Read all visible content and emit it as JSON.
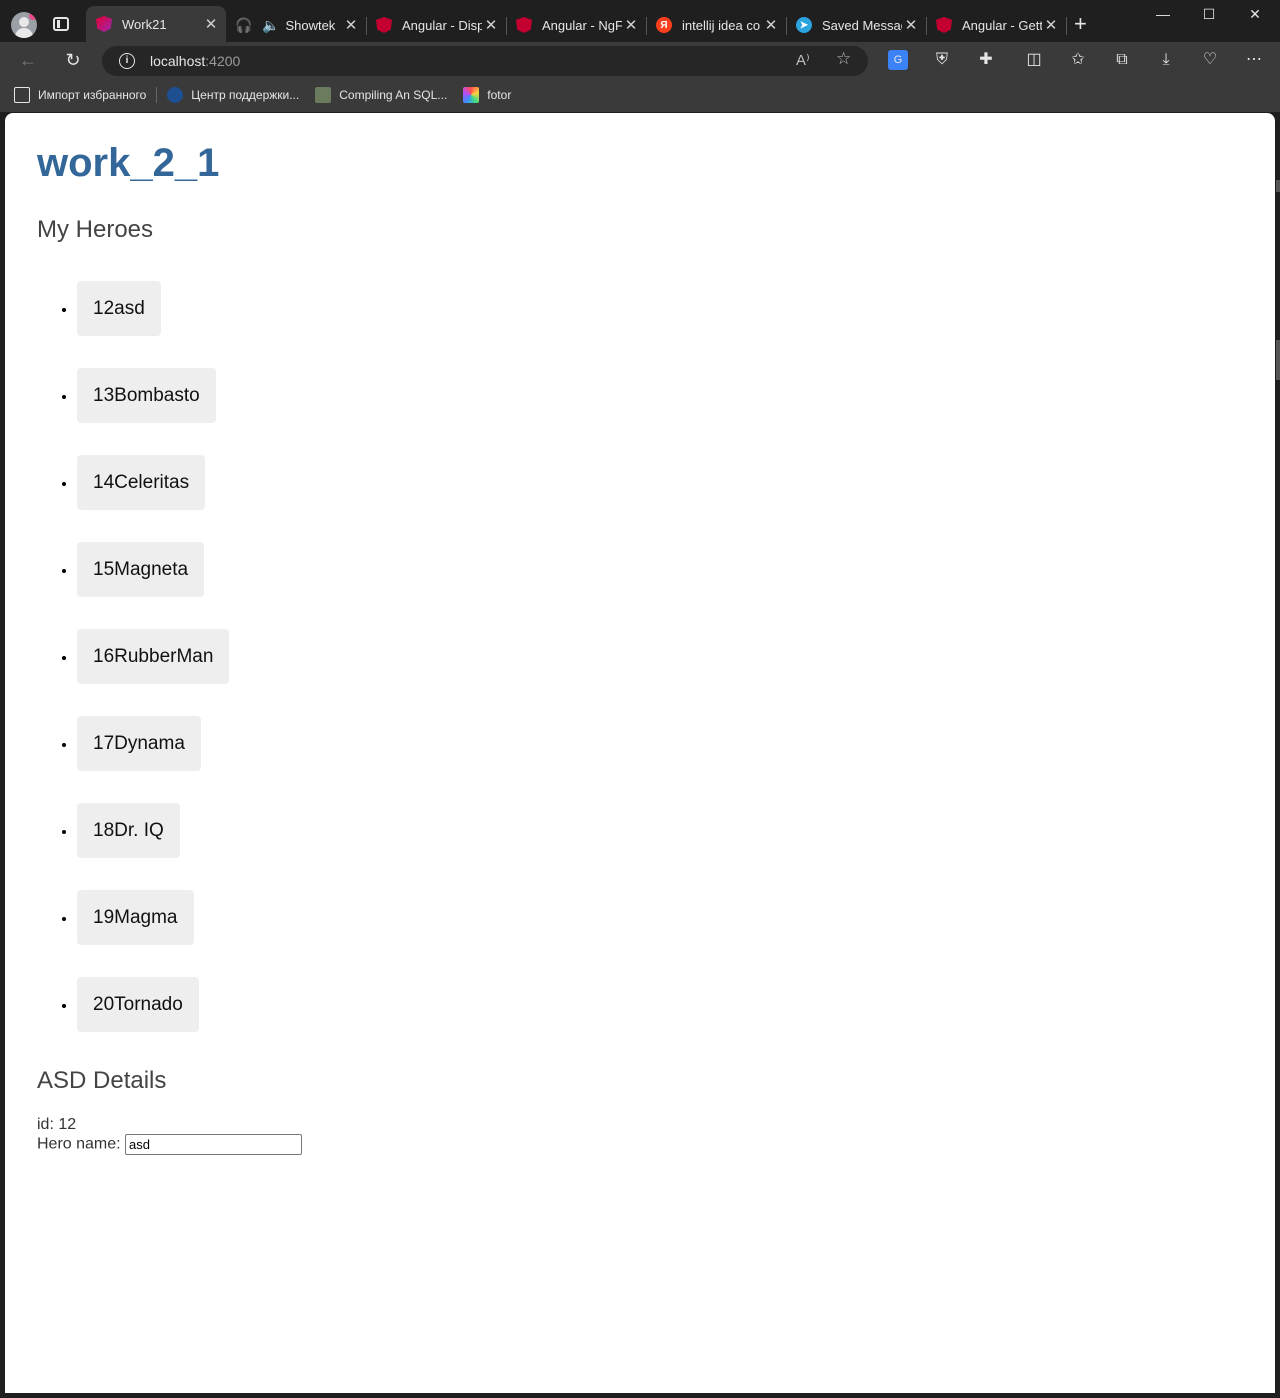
{
  "browser": {
    "tabs": [
      {
        "title": "Work21",
        "favicon": "angular-gradient-icon",
        "active": true
      },
      {
        "title": "Showtek",
        "favicon": "audio-headset-icon",
        "active": false,
        "audio": true
      },
      {
        "title": "Angular - Disp",
        "favicon": "angular-icon",
        "active": false
      },
      {
        "title": "Angular - NgF",
        "favicon": "angular-icon",
        "active": false
      },
      {
        "title": "intellij idea co",
        "favicon": "yandex-icon",
        "active": false
      },
      {
        "title": "Saved Messag",
        "favicon": "telegram-icon",
        "active": false
      },
      {
        "title": "Angular - Gett",
        "favicon": "angular-icon",
        "active": false
      }
    ],
    "address": {
      "host": "localhost",
      "port": ":4200"
    },
    "bookmarks": [
      {
        "label": "Импорт избранного",
        "icon": "import-favorites-icon"
      },
      {
        "label": "Центр поддержки...",
        "icon": "support-center-icon"
      },
      {
        "label": "Compiling An SQL...",
        "icon": "sql-icon"
      },
      {
        "label": "fotor",
        "icon": "fotor-icon"
      }
    ],
    "colors": {
      "frame": "#1f1f1f",
      "toolbar": "#3a3a3a",
      "accent_title": "#336699"
    }
  },
  "page": {
    "app_title": "work_2_1",
    "heroes_heading": "My Heroes",
    "heroes": [
      {
        "id": "12",
        "name": "asd"
      },
      {
        "id": "13",
        "name": "Bombasto"
      },
      {
        "id": "14",
        "name": "Celeritas"
      },
      {
        "id": "15",
        "name": "Magneta"
      },
      {
        "id": "16",
        "name": "RubberMan"
      },
      {
        "id": "17",
        "name": "Dynama"
      },
      {
        "id": "18",
        "name": "Dr. IQ"
      },
      {
        "id": "19",
        "name": "Magma"
      },
      {
        "id": "20",
        "name": "Tornado"
      }
    ],
    "details": {
      "heading": "ASD Details",
      "id_label": "id: ",
      "id_value": "12",
      "name_label": "Hero name: ",
      "name_value": "asd"
    }
  }
}
